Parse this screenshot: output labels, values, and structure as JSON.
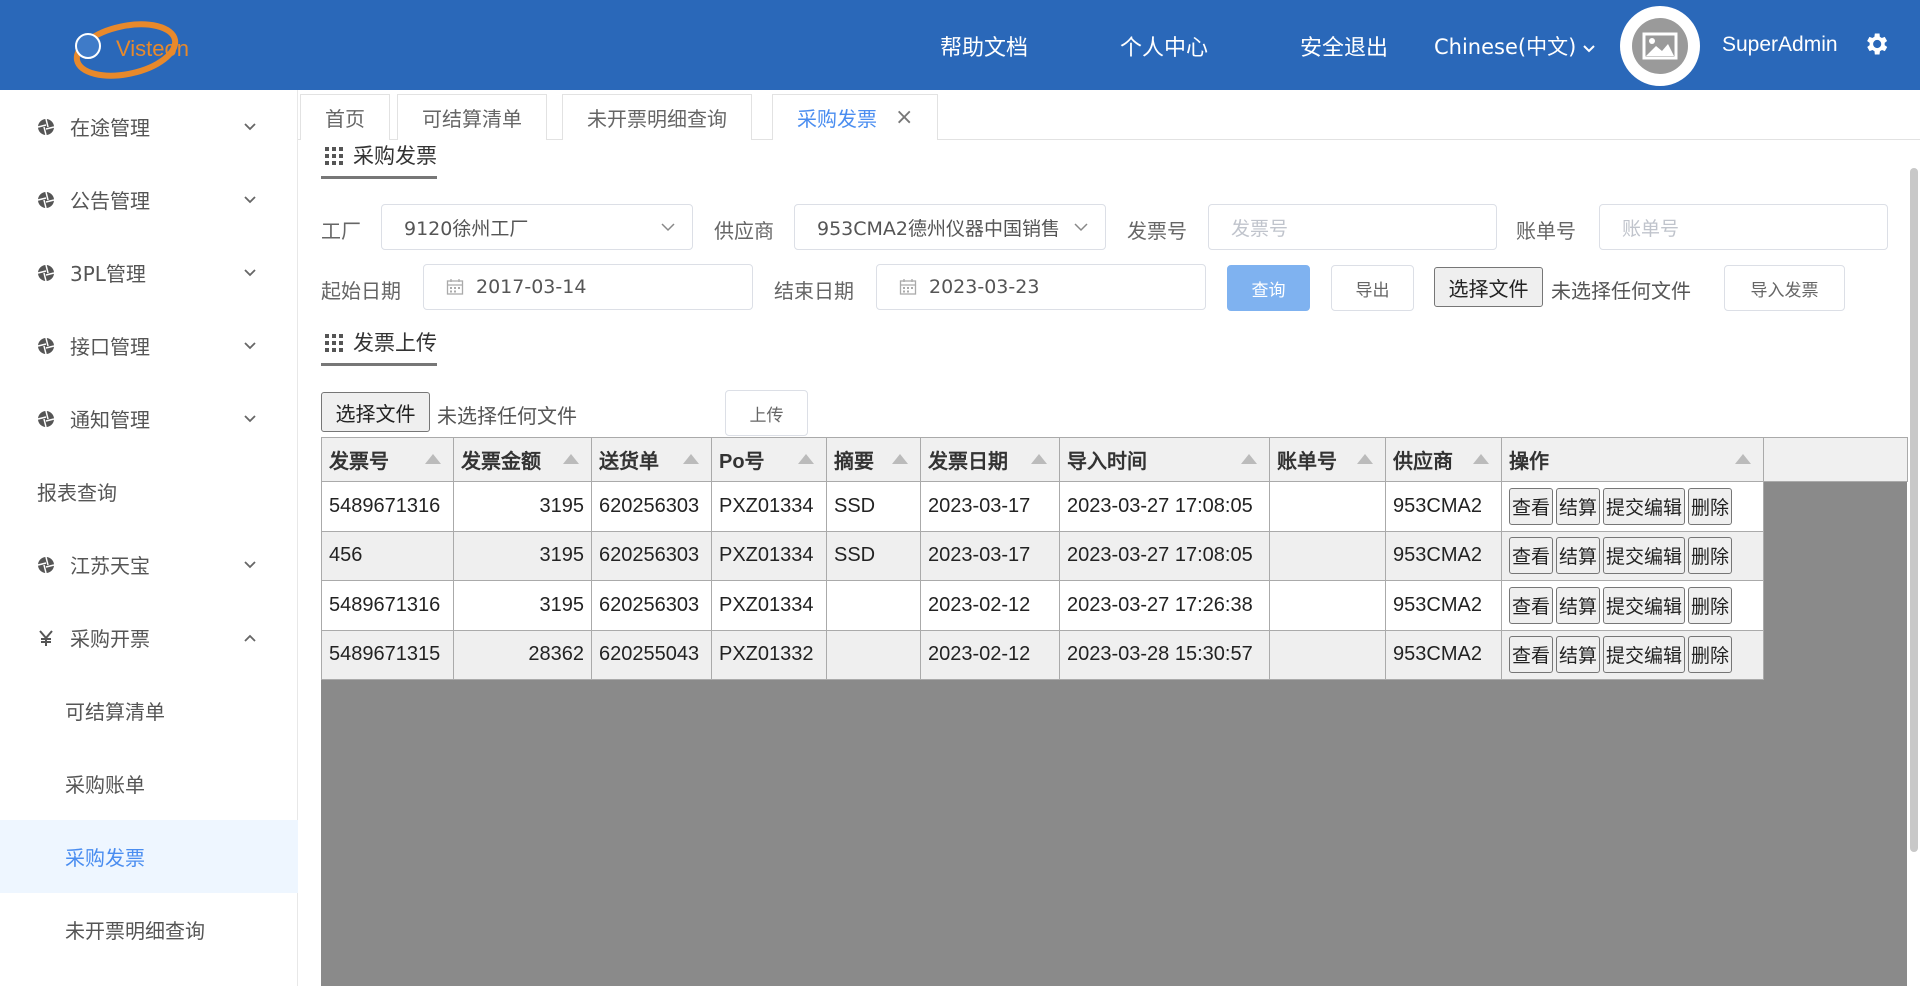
{
  "header": {
    "logo_text": "Visteon",
    "links": [
      "帮助文档",
      "个人中心",
      "安全退出"
    ],
    "language": "Chinese(中文)",
    "username": "SuperAdmin",
    "settings_icon": "gear-icon"
  },
  "sidebar": {
    "items": [
      {
        "label": "在途管理",
        "icon": "aperture-icon",
        "expanded": false
      },
      {
        "label": "公告管理",
        "icon": "aperture-icon",
        "expanded": false
      },
      {
        "label": "3PL管理",
        "icon": "aperture-icon",
        "expanded": false
      },
      {
        "label": "接口管理",
        "icon": "aperture-icon",
        "expanded": false
      },
      {
        "label": "通知管理",
        "icon": "aperture-icon",
        "expanded": false
      },
      {
        "label": "报表查询"
      },
      {
        "label": "江苏天宝",
        "icon": "aperture-icon",
        "expanded": false
      },
      {
        "label": "采购开票",
        "icon": "yen-icon",
        "expanded": true
      }
    ],
    "sub_items": [
      {
        "label": "可结算清单"
      },
      {
        "label": "采购账单"
      },
      {
        "label": "采购发票",
        "active": true
      },
      {
        "label": "未开票明细查询"
      }
    ]
  },
  "tabs": [
    {
      "label": "首页"
    },
    {
      "label": "可结算清单"
    },
    {
      "label": "未开票明细查询"
    },
    {
      "label": "采购发票",
      "active": true,
      "closable": true
    }
  ],
  "section1_title": "采购发票",
  "form": {
    "factory_label": "工厂",
    "factory_value": "9120徐州工厂",
    "supplier_label": "供应商",
    "supplier_value": "953CMA2德州仪器中国销售",
    "invoice_no_label": "发票号",
    "invoice_no_placeholder": "发票号",
    "bill_no_label": "账单号",
    "bill_no_placeholder": "账单号",
    "start_date_label": "起始日期",
    "start_date_value": "2017-03-14",
    "end_date_label": "结束日期",
    "end_date_value": "2023-03-23",
    "query_label": "查询",
    "export_label": "导出",
    "choose_file_label": "选择文件",
    "no_file_text": "未选择任何文件",
    "import_label": "导入发票"
  },
  "section2_title": "发票上传",
  "upload": {
    "choose_file_label": "选择文件",
    "no_file_text": "未选择任何文件",
    "upload_label": "上传"
  },
  "table": {
    "columns": [
      "发票号",
      "发票金额",
      "送货单",
      "Po号",
      "摘要",
      "发票日期",
      "导入时间",
      "账单号",
      "供应商",
      "操作"
    ],
    "rows": [
      {
        "invoice_no": "5489671316",
        "amount": "3195",
        "delivery": "620256303",
        "po": "PXZ01334",
        "summary": "SSD",
        "invoice_date": "2023-03-17",
        "import_time": "2023-03-27 17:08:05",
        "bill_no": "",
        "supplier": "953CMA2"
      },
      {
        "invoice_no": "456",
        "amount": "3195",
        "delivery": "620256303",
        "po": "PXZ01334",
        "summary": "SSD",
        "invoice_date": "2023-03-17",
        "import_time": "2023-03-27 17:08:05",
        "bill_no": "",
        "supplier": "953CMA2"
      },
      {
        "invoice_no": "5489671316",
        "amount": "3195",
        "delivery": "620256303",
        "po": "PXZ01334",
        "summary": "",
        "invoice_date": "2023-02-12",
        "import_time": "2023-03-27 17:26:38",
        "bill_no": "",
        "supplier": "953CMA2"
      },
      {
        "invoice_no": "5489671315",
        "amount": "28362",
        "delivery": "620255043",
        "po": "PXZ01332",
        "summary": "",
        "invoice_date": "2023-02-12",
        "import_time": "2023-03-28 15:30:57",
        "bill_no": "",
        "supplier": "953CMA2"
      }
    ],
    "actions": [
      "查看",
      "结算",
      "提交编辑",
      "删除"
    ]
  }
}
